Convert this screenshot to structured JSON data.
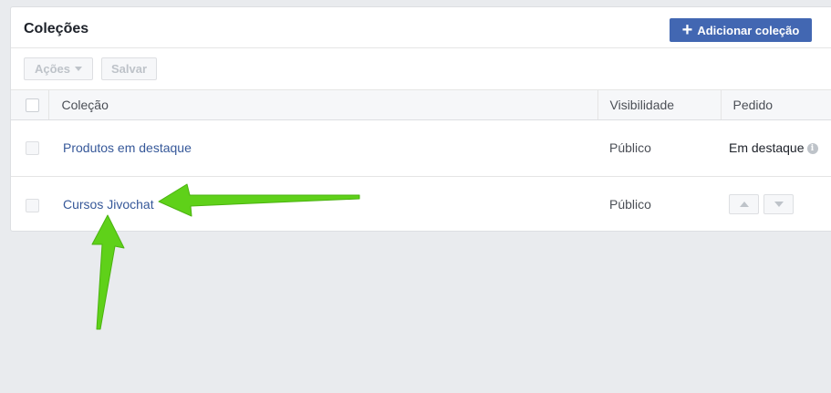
{
  "panel": {
    "title": "Coleções",
    "add_button_label": "Adicionar coleção",
    "add_button_icon": "plus-icon"
  },
  "toolbar": {
    "actions_label": "Ações",
    "save_label": "Salvar"
  },
  "table": {
    "columns": [
      "Coleção",
      "Visibilidade",
      "Pedido"
    ],
    "rows": [
      {
        "name": "Produtos em destaque",
        "visibility": "Público",
        "order": "Em destaque"
      },
      {
        "name": "Cursos Jivochat",
        "visibility": "Público",
        "order": ""
      }
    ]
  },
  "colors": {
    "accent": "#4267b2",
    "link": "#365899",
    "annotation_arrow": "#5fd119"
  }
}
